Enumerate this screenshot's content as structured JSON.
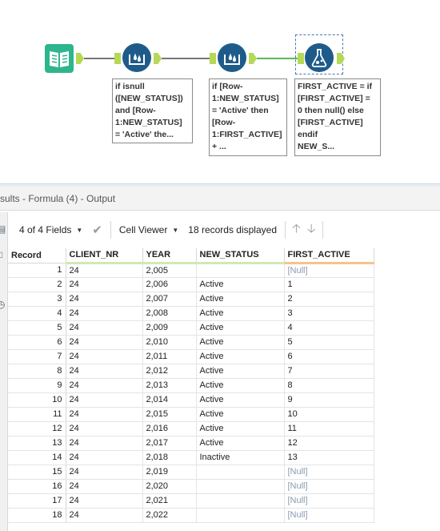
{
  "workflow": {
    "annotations": [
      "if isnull\n([NEW_STATUS])\nand [Row-\n1:NEW_STATUS]\n= 'Active' the...",
      "if [Row-\n1:NEW_STATUS]\n= 'Active' then\n[Row-\n1:FIRST_ACTIVE]\n+ ...",
      "FIRST_ACTIVE = if\n[FIRST_ACTIVE] =\n0 then null() else\n[FIRST_ACTIVE]\nendif\nNEW_S..."
    ]
  },
  "results": {
    "title": "sults - Formula (4) - Output",
    "fields_label": "4 of 4 Fields",
    "viewer_label": "Cell Viewer",
    "records_label": "18 records displayed",
    "columns": [
      "Record",
      "CLIENT_NR",
      "YEAR",
      "NEW_STATUS",
      "FIRST_ACTIVE"
    ],
    "rows": [
      [
        "1",
        "24",
        "2,005",
        "",
        "[Null]"
      ],
      [
        "2",
        "24",
        "2,006",
        "Active",
        "1"
      ],
      [
        "3",
        "24",
        "2,007",
        "Active",
        "2"
      ],
      [
        "4",
        "24",
        "2,008",
        "Active",
        "3"
      ],
      [
        "5",
        "24",
        "2,009",
        "Active",
        "4"
      ],
      [
        "6",
        "24",
        "2,010",
        "Active",
        "5"
      ],
      [
        "7",
        "24",
        "2,011",
        "Active",
        "6"
      ],
      [
        "8",
        "24",
        "2,012",
        "Active",
        "7"
      ],
      [
        "9",
        "24",
        "2,013",
        "Active",
        "8"
      ],
      [
        "10",
        "24",
        "2,014",
        "Active",
        "9"
      ],
      [
        "11",
        "24",
        "2,015",
        "Active",
        "10"
      ],
      [
        "12",
        "24",
        "2,016",
        "Active",
        "11"
      ],
      [
        "13",
        "24",
        "2,017",
        "Active",
        "12"
      ],
      [
        "14",
        "24",
        "2,018",
        "Inactive",
        "13"
      ],
      [
        "15",
        "24",
        "2,019",
        "",
        "[Null]"
      ],
      [
        "16",
        "24",
        "2,020",
        "",
        "[Null]"
      ],
      [
        "17",
        "24",
        "2,021",
        "",
        "[Null]"
      ],
      [
        "18",
        "24",
        "2,022",
        "",
        "[Null]"
      ]
    ]
  }
}
